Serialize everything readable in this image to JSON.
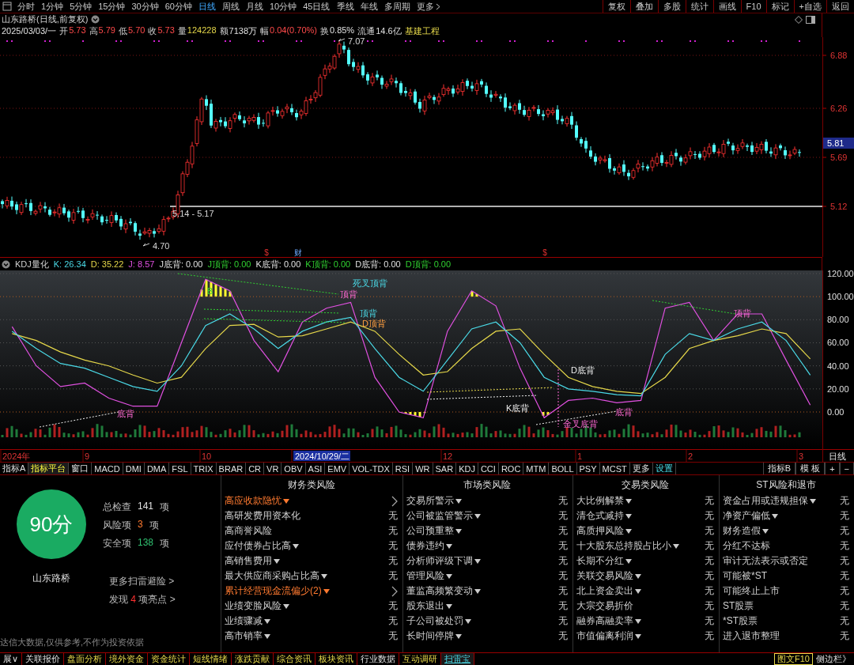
{
  "toolbar": {
    "periods": [
      {
        "label": "分时",
        "selected": false
      },
      {
        "label": "1分钟",
        "selected": false
      },
      {
        "label": "5分钟",
        "selected": false
      },
      {
        "label": "15分钟",
        "selected": false
      },
      {
        "label": "30分钟",
        "selected": false
      },
      {
        "label": "60分钟",
        "selected": false
      },
      {
        "label": "日线",
        "selected": true
      },
      {
        "label": "周线",
        "selected": false
      },
      {
        "label": "月线",
        "selected": false
      },
      {
        "label": "10分钟",
        "selected": false
      },
      {
        "label": "45日线",
        "selected": false
      },
      {
        "label": "季线",
        "selected": false
      },
      {
        "label": "年线",
        "selected": false
      },
      {
        "label": "多周期",
        "selected": false
      }
    ],
    "more": "更多",
    "buttons": [
      "复权",
      "叠加",
      "多股",
      "统计",
      "画线",
      "F10",
      "标记",
      "+自选",
      "返回"
    ]
  },
  "quote": {
    "title": "山东路桥(日线,前复权)",
    "date": "2025/03/03/一",
    "fields": [
      {
        "label": "开",
        "value": "5.73",
        "kind": "up"
      },
      {
        "label": "高",
        "value": "5.79",
        "kind": "up"
      },
      {
        "label": "低",
        "value": "5.70",
        "kind": "up"
      },
      {
        "label": "收",
        "value": "5.73",
        "kind": "up"
      },
      {
        "label": "量",
        "value": "124228",
        "kind": "volume"
      },
      {
        "label": "额",
        "value": "7138万",
        "kind": "plain"
      },
      {
        "label": "幅",
        "value": "0.04(0.70%)",
        "kind": "up"
      },
      {
        "label": "换",
        "value": "0.85%",
        "kind": "plain"
      },
      {
        "label": "流通",
        "value": "14.6亿",
        "kind": "plain"
      }
    ],
    "industry": "基建工程"
  },
  "price_chart": {
    "axis_labels": [
      "6.88",
      "6.26",
      "5.69",
      "5.12"
    ],
    "current_price": "5.81",
    "annotations": [
      "7.07",
      "4.70",
      "5.14 - 5.17"
    ],
    "events": [
      {
        "text": "$",
        "kind": "dividend"
      },
      {
        "text": "财",
        "kind": "report"
      },
      {
        "text": "$",
        "kind": "dividend"
      }
    ]
  },
  "kdj": {
    "name": "KDJ量化",
    "values": [
      {
        "text": ": 26.34",
        "kind": "k"
      },
      {
        "text": ": 35.22",
        "kind": "d"
      },
      {
        "text": ": 8.57",
        "kind": "j"
      },
      {
        "text": "J底背: 0.00",
        "kind": "bottom"
      },
      {
        "text": "J顶背: 0.00",
        "kind": "top"
      },
      {
        "text": "K底背: 0.00",
        "kind": "bottom"
      },
      {
        "text": "K顶背: 0.00",
        "kind": "top"
      },
      {
        "text": "D底背: 0.00",
        "kind": "bottom"
      },
      {
        "text": "D顶背: 0.00",
        "kind": "top"
      }
    ],
    "chart_data": {
      "type": "line",
      "grid": true,
      "ylim": [
        -43.17,
        122.7
      ],
      "categories": [
        null,
        null,
        null,
        null,
        null,
        null,
        null,
        null,
        null,
        null,
        null,
        null,
        null,
        null,
        null,
        null,
        null,
        null,
        null,
        null,
        null,
        null,
        null,
        null,
        null,
        null,
        null,
        null,
        null,
        null,
        null,
        null,
        null,
        null
      ],
      "yticks": [
        {
          "value": 120,
          "label": "120.00"
        },
        {
          "value": 100,
          "label": "100.00"
        },
        {
          "value": 80,
          "label": "80.00"
        },
        {
          "value": 60,
          "label": "60.00"
        },
        {
          "value": 40,
          "label": "40.00"
        },
        {
          "value": 20,
          "label": "20.00"
        },
        {
          "value": 0,
          "label": "0.00"
        }
      ],
      "series": [
        {
          "name": "K",
          "color": "#4ad9e6",
          "values": [
            70,
            55,
            42,
            38,
            30,
            22,
            18,
            40,
            75,
            85,
            72,
            55,
            70,
            78,
            82,
            55,
            30,
            18,
            45,
            72,
            78,
            60,
            30,
            20,
            18,
            15,
            14,
            50,
            68,
            62,
            72,
            78,
            62,
            32
          ]
        },
        {
          "name": "D",
          "color": "#e6d84a",
          "values": [
            68,
            62,
            52,
            45,
            40,
            32,
            25,
            30,
            55,
            75,
            76,
            65,
            66,
            72,
            78,
            70,
            50,
            32,
            35,
            55,
            70,
            72,
            50,
            30,
            22,
            18,
            16,
            30,
            55,
            62,
            66,
            72,
            68,
            46
          ]
        },
        {
          "name": "J",
          "color": "#e050e0",
          "values": [
            74,
            40,
            22,
            25,
            12,
            5,
            5,
            60,
            115,
            105,
            62,
            35,
            78,
            90,
            95,
            30,
            0,
            -5,
            70,
            105,
            92,
            38,
            -5,
            10,
            12,
            8,
            10,
            90,
            95,
            62,
            85,
            85,
            45,
            6
          ]
        }
      ]
    },
    "annotations": [
      {
        "text": "死叉顶背",
        "kind": "crosstop"
      },
      {
        "text": "顶背",
        "kind": "jtop"
      },
      {
        "text": "顶背",
        "kind": "ktop"
      },
      {
        "text": "D顶背",
        "kind": "dtop"
      },
      {
        "text": "B",
        "kind": "buy"
      },
      {
        "text": "底背",
        "kind": "jbottom"
      },
      {
        "text": "D底背",
        "kind": "dbottom"
      },
      {
        "text": "K底背",
        "kind": "kbottom"
      },
      {
        "text": "底背",
        "kind": "jbottom"
      },
      {
        "text": "金叉底背",
        "kind": "crossbottom"
      },
      {
        "text": "顶背",
        "kind": "jtop"
      }
    ]
  },
  "date_axis": {
    "labels": [
      "2024年",
      "9",
      "10",
      "2024/10/29/二",
      "12",
      "1",
      "2",
      "3"
    ],
    "period": "日线"
  },
  "indicator_tabs": {
    "items": [
      {
        "label": "指标A",
        "kind": "tab",
        "selected": false
      },
      {
        "label": "指标平台",
        "kind": "tab",
        "selected": true
      },
      {
        "label": "窗口",
        "kind": "tab",
        "selected": false
      },
      {
        "label": "MACD",
        "kind": "tab",
        "selected": false
      },
      {
        "label": "DMI",
        "kind": "tab",
        "selected": false
      },
      {
        "label": "DMA",
        "kind": "tab",
        "selected": false
      },
      {
        "label": "FSL",
        "kind": "tab",
        "selected": false
      },
      {
        "label": "TRIX",
        "kind": "tab",
        "selected": false
      },
      {
        "label": "BRAR",
        "kind": "tab",
        "selected": false
      },
      {
        "label": "CR",
        "kind": "tab",
        "selected": false
      },
      {
        "label": "VR",
        "kind": "tab",
        "selected": false
      },
      {
        "label": "OBV",
        "kind": "tab",
        "selected": false
      },
      {
        "label": "ASI",
        "kind": "tab",
        "selected": false
      },
      {
        "label": "EMV",
        "kind": "tab",
        "selected": false
      },
      {
        "label": "VOL-TDX",
        "kind": "tab",
        "selected": false
      },
      {
        "label": "RSI",
        "kind": "tab",
        "selected": false
      },
      {
        "label": "WR",
        "kind": "tab",
        "selected": false
      },
      {
        "label": "SAR",
        "kind": "tab",
        "selected": false
      },
      {
        "label": "KDJ",
        "kind": "tab",
        "selected": false
      },
      {
        "label": "CCI",
        "kind": "tab",
        "selected": false
      },
      {
        "label": "ROC",
        "kind": "tab",
        "selected": false
      },
      {
        "label": "MTM",
        "kind": "tab",
        "selected": false
      },
      {
        "label": "BOLL",
        "kind": "tab",
        "selected": false
      },
      {
        "label": "PSY",
        "kind": "tab",
        "selected": false
      },
      {
        "label": "MCST",
        "kind": "tab",
        "selected": false
      },
      {
        "label": "更多",
        "kind": "tab",
        "selected": false
      },
      {
        "label": "设置",
        "kind": "action",
        "selected": false
      }
    ],
    "right": [
      "指标B",
      "模 板",
      "+",
      "−"
    ]
  },
  "risk": {
    "score": "90分",
    "company": "山东路桥",
    "stats": [
      {
        "label": "总检查",
        "value": "141",
        "unit": "项",
        "kind": "total"
      },
      {
        "label": "风险项",
        "value": "3",
        "unit": "项",
        "kind": "risk"
      },
      {
        "label": "安全项",
        "value": "138",
        "unit": "项",
        "kind": "safe"
      }
    ],
    "more_link": "更多扫雷避险 >",
    "highlights": {
      "prefix": "发现",
      "count": "4",
      "suffix": "项亮点 >"
    },
    "disclaimer": "达信大数据,仅供参考,不作为投资依据",
    "columns": [
      {
        "title": "财务类风险",
        "rows": [
          {
            "label": "高应收款隐忧",
            "dropdown": true,
            "risk": true
          },
          {
            "label": "高研发费用资本化",
            "dropdown": false,
            "risk": false,
            "value": "无"
          },
          {
            "label": "高商誉风险",
            "dropdown": false,
            "risk": false,
            "value": "无"
          },
          {
            "label": "应付债券占比高",
            "dropdown": true,
            "risk": false,
            "value": "无"
          },
          {
            "label": "高销售费用",
            "dropdown": true,
            "risk": false,
            "value": "无"
          },
          {
            "label": "最大供应商采购占比高",
            "dropdown": true,
            "risk": false,
            "value": "无"
          },
          {
            "label": "累计经营现金流偏少(2)",
            "dropdown": true,
            "risk": true
          },
          {
            "label": "业绩变脸风险",
            "dropdown": true,
            "risk": false,
            "value": "无"
          },
          {
            "label": "业绩骤减",
            "dropdown": true,
            "risk": false,
            "value": "无"
          },
          {
            "label": "高市销率",
            "dropdown": true,
            "risk": false,
            "value": "无"
          }
        ]
      },
      {
        "title": "市场类风险",
        "rows": [
          {
            "label": "交易所警示",
            "dropdown": true,
            "risk": false,
            "value": "无"
          },
          {
            "label": "公司被监管警示",
            "dropdown": true,
            "risk": false,
            "value": "无"
          },
          {
            "label": "公司预重整",
            "dropdown": true,
            "risk": false,
            "value": "无"
          },
          {
            "label": "债券违约",
            "dropdown": true,
            "risk": false,
            "value": "无"
          },
          {
            "label": "分析师评级下调",
            "dropdown": true,
            "risk": false,
            "value": "无"
          },
          {
            "label": "管理风险",
            "dropdown": true,
            "risk": false,
            "value": "无"
          },
          {
            "label": "董监高频繁变动",
            "dropdown": true,
            "risk": false,
            "value": "无"
          },
          {
            "label": "股东退出",
            "dropdown": true,
            "risk": false,
            "value": "无"
          },
          {
            "label": "子公司被处罚",
            "dropdown": true,
            "risk": false,
            "value": "无"
          },
          {
            "label": "长时间停牌",
            "dropdown": true,
            "risk": false,
            "value": "无"
          }
        ]
      },
      {
        "title": "交易类风险",
        "rows": [
          {
            "label": "大比例解禁",
            "dropdown": true,
            "risk": false,
            "value": "无"
          },
          {
            "label": "清仓式减持",
            "dropdown": true,
            "risk": false,
            "value": "无"
          },
          {
            "label": "高质押风险",
            "dropdown": true,
            "risk": false,
            "value": "无"
          },
          {
            "label": "十大股东总持股占比小",
            "dropdown": true,
            "risk": false,
            "value": "无"
          },
          {
            "label": "长期不分红",
            "dropdown": true,
            "risk": false,
            "value": "无"
          },
          {
            "label": "关联交易风险",
            "dropdown": true,
            "risk": false,
            "value": "无"
          },
          {
            "label": "北上资金卖出",
            "dropdown": true,
            "risk": false,
            "value": "无"
          },
          {
            "label": "大宗交易折价",
            "dropdown": false,
            "risk": false,
            "value": "无"
          },
          {
            "label": "融券高融卖率",
            "dropdown": true,
            "risk": false,
            "value": "无"
          },
          {
            "label": "市值偏离利润",
            "dropdown": true,
            "risk": false,
            "value": "无"
          }
        ]
      },
      {
        "title": "ST风险和退市",
        "rows": [
          {
            "label": "资金占用或违规担保",
            "dropdown": true,
            "risk": false,
            "value": "无"
          },
          {
            "label": "净资产偏低",
            "dropdown": true,
            "risk": false,
            "value": "无"
          },
          {
            "label": "财务造假",
            "dropdown": true,
            "risk": false,
            "value": "无"
          },
          {
            "label": "分红不达标",
            "dropdown": false,
            "risk": false,
            "value": "无"
          },
          {
            "label": "审计无法表示或否定",
            "dropdown": false,
            "risk": false,
            "value": "无"
          },
          {
            "label": "可能被*ST",
            "dropdown": false,
            "risk": false,
            "value": "无"
          },
          {
            "label": "可能终止上市",
            "dropdown": false,
            "risk": false,
            "value": "无"
          },
          {
            "label": "ST股票",
            "dropdown": false,
            "risk": false,
            "value": "无"
          },
          {
            "label": "*ST股票",
            "dropdown": false,
            "risk": false,
            "value": "无"
          },
          {
            "label": "进入退市整理",
            "dropdown": false,
            "risk": false,
            "value": "无"
          }
        ]
      }
    ]
  },
  "status_bar": {
    "items": [
      {
        "label": "展∨",
        "kind": "basic",
        "selected": false
      },
      {
        "label": "关联报价",
        "kind": "basic",
        "selected": false
      },
      {
        "label": "盘面分析",
        "kind": "feature",
        "selected": false
      },
      {
        "label": "境外资金",
        "kind": "feature",
        "selected": false
      },
      {
        "label": "资金统计",
        "kind": "feature",
        "selected": false
      },
      {
        "label": "短线情绪",
        "kind": "feature",
        "selected": false
      },
      {
        "label": "涨跌贡献",
        "kind": "feature",
        "selected": false
      },
      {
        "label": "综合资讯",
        "kind": "feature",
        "selected": false
      },
      {
        "label": "板块资讯",
        "kind": "feature",
        "selected": false
      },
      {
        "label": "行业数据",
        "kind": "basic",
        "selected": false
      },
      {
        "label": "互动调研",
        "kind": "feature",
        "selected": false
      },
      {
        "label": "扫雷宝",
        "kind": "feature",
        "selected": true
      }
    ],
    "right": [
      "图文F10",
      "侧边栏》"
    ]
  }
}
